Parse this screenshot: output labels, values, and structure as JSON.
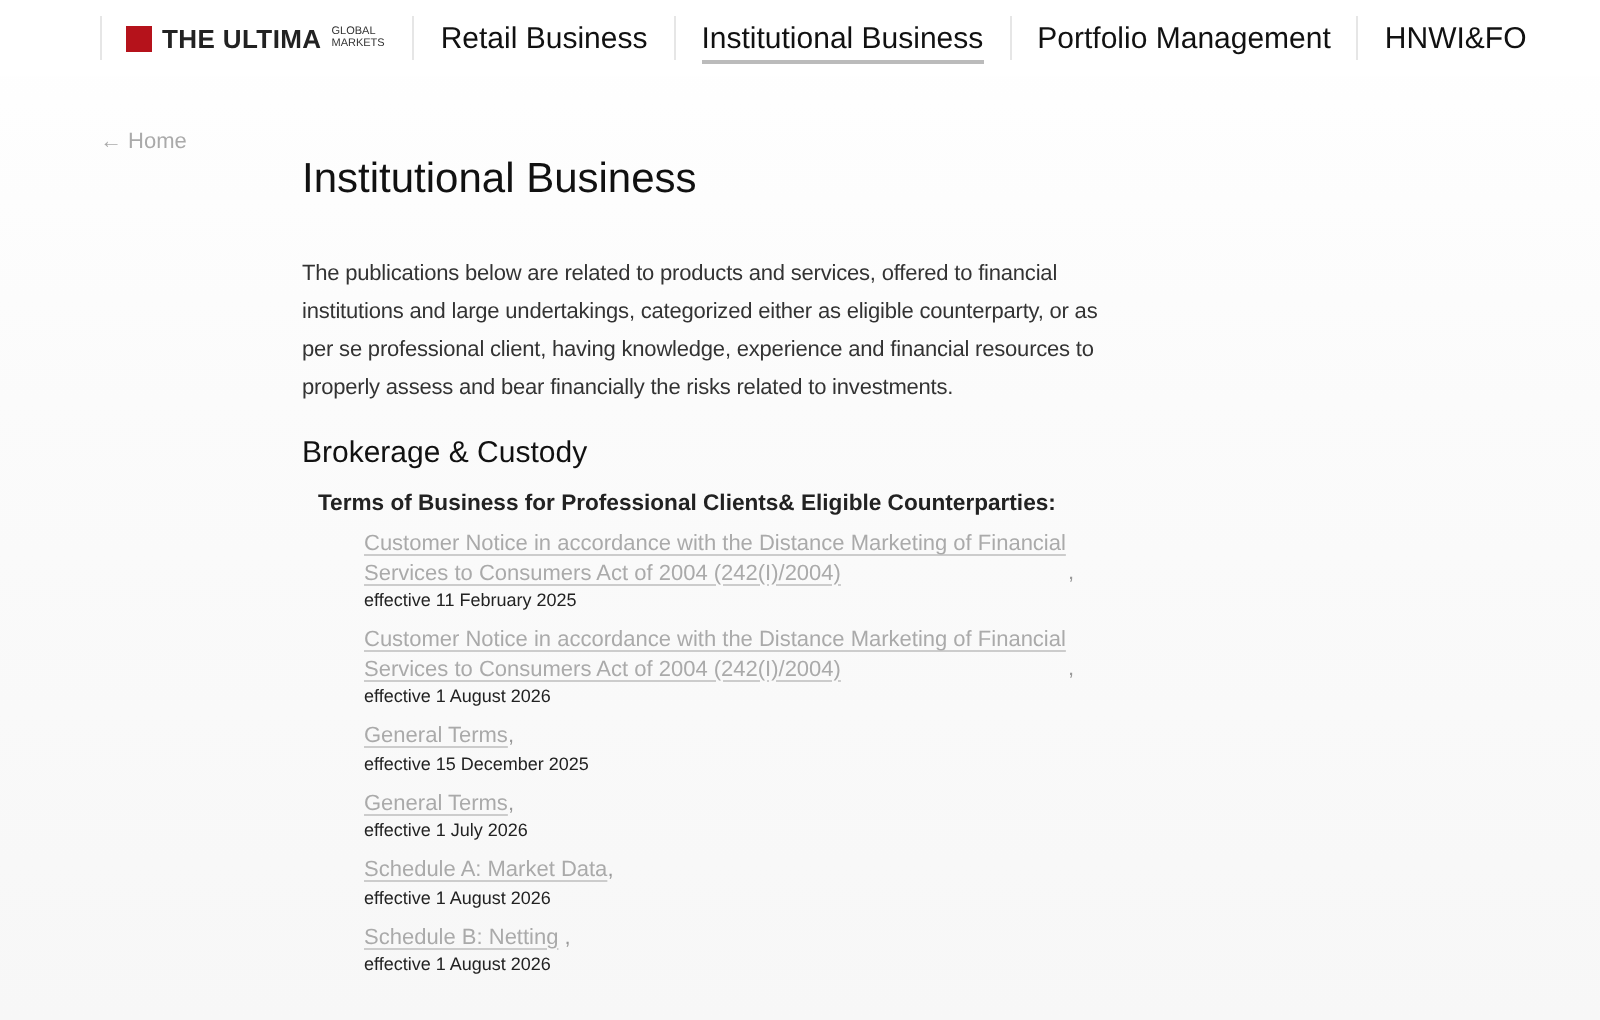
{
  "header": {
    "logo": {
      "name": "THE ULTIMA",
      "tag_top": "GLOBAL",
      "tag_bottom": "MARKETS"
    },
    "nav": [
      {
        "label": "Retail Business",
        "selected": false
      },
      {
        "label": "Institutional Business",
        "selected": true
      },
      {
        "label": "Portfolio Management",
        "selected": false
      },
      {
        "label": "HNWI&FO",
        "selected": false
      }
    ]
  },
  "back_link": "← Home",
  "page_title": "Institutional Business",
  "intro": "The publications below are related to products and services, offered to financial institutions and large undertakings, categorized either as eligible counterparty, or as per se professional client, having knowledge, experience and financial resources to properly assess and bear financially the risks related to investments.",
  "section": {
    "title": "Brokerage & Custody",
    "group_title": "Terms of Business for Professional Clients& Eligible Counterparties:",
    "documents": [
      {
        "title": "Customer Notice in accordance with the Distance Marketing of Financial Services to Consumers Act of 2004 (242(I)/2004)",
        "punct": ",",
        "effective": "effective 11 February 2025"
      },
      {
        "title": "Customer Notice in accordance with the Distance Marketing of Financial Services to Consumers Act of 2004 (242(I)/2004)",
        "punct": ",",
        "effective": "effective 1 August 2026"
      },
      {
        "title": "General Terms",
        "punct": ",",
        "effective": "effective 15 December 2025"
      },
      {
        "title": "General Terms",
        "punct": ",",
        "effective": "effective 1 July 2026"
      },
      {
        "title": "Schedule A: Market Data",
        "punct": ",",
        "effective": "effective 1 August 2026"
      },
      {
        "title": "Schedule B: Netting",
        "punct": " ,",
        "effective": "effective 1 August 2026"
      }
    ]
  }
}
